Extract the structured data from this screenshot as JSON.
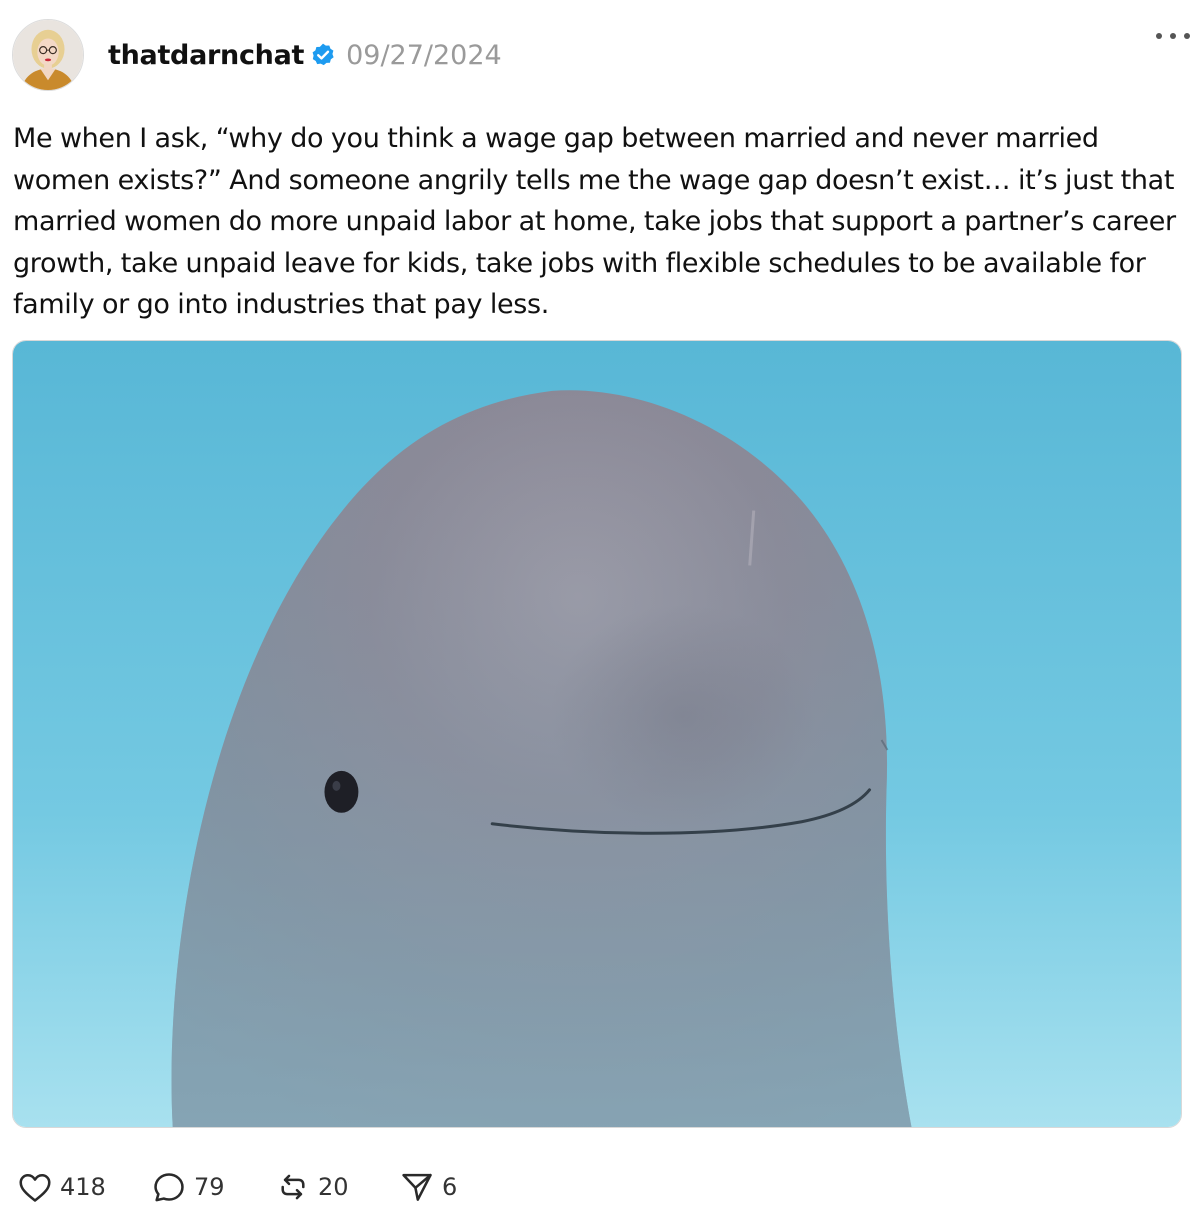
{
  "post": {
    "username": "thatdarnchat",
    "date": "09/27/2024",
    "body": "Me when I ask, “why do you think a wage gap between married and never married women exists?” And someone angrily tells me the wage gap doesn’t exist… it’s just that married women do more unpaid labor at home, take jobs that support a partner’s career growth, take unpaid leave for kids, take jobs with flexible schedules to be available for family or go into industries that pay less."
  },
  "actions": {
    "likes": "418",
    "replies": "79",
    "reposts": "20",
    "shares": "6"
  },
  "icons": {
    "avatar": "avatar-photo",
    "verified": "verified-badge-icon",
    "more": "more-options-icon",
    "like": "heart-icon",
    "reply": "comment-icon",
    "repost": "repost-icon",
    "share": "share-icon"
  },
  "colors": {
    "verified": "#1d9bf0",
    "date": "#9a9a9a",
    "image_sky": "#6cc6e0"
  }
}
